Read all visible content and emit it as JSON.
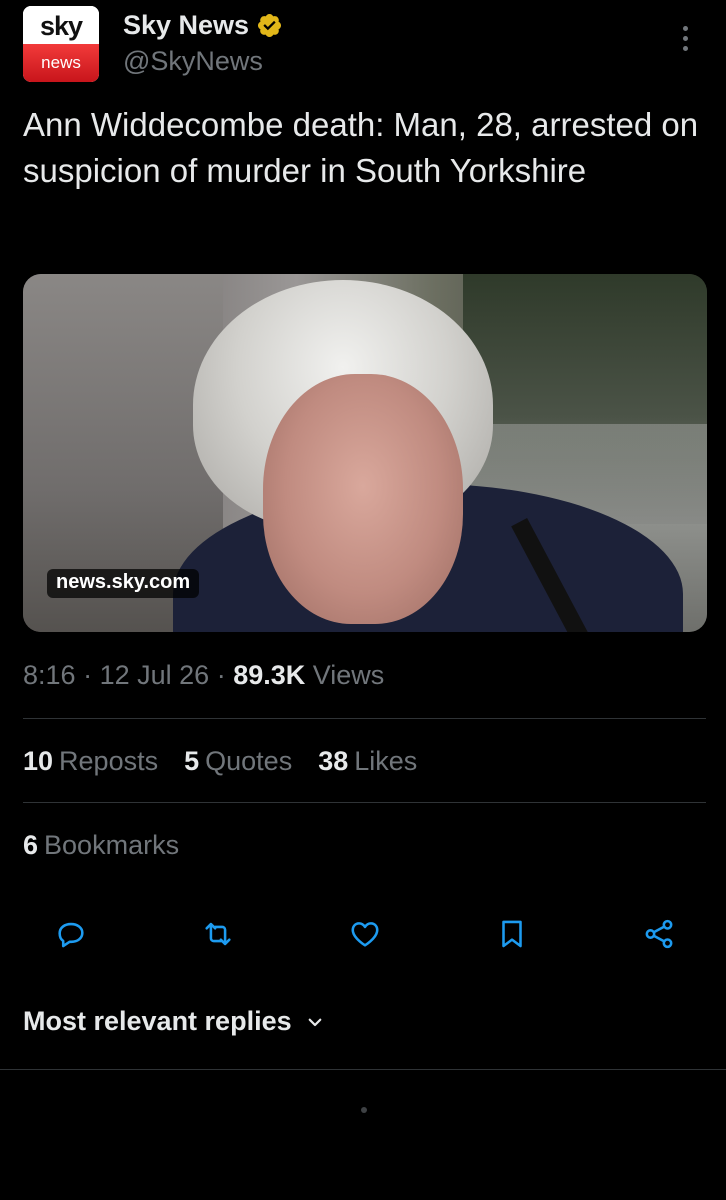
{
  "account": {
    "avatar_top": "sky",
    "avatar_bottom": "news",
    "display_name": "Sky News",
    "handle": "@SkyNews",
    "verified_icon": "verified-badge-icon"
  },
  "tweet": {
    "text": "Ann Widdecombe death: Man, 28, arrested on suspicion of murder in South Yorkshire",
    "link_domain": "news.sky.com"
  },
  "meta": {
    "time": "8:16",
    "date": "12 Jul 26",
    "views_count": "89.3K",
    "views_label": "Views"
  },
  "stats": {
    "reposts_count": "10",
    "reposts_label": "Reposts",
    "quotes_count": "5",
    "quotes_label": "Quotes",
    "likes_count": "38",
    "likes_label": "Likes",
    "bookmarks_count": "6",
    "bookmarks_label": "Bookmarks"
  },
  "actions": [
    "reply-icon",
    "repost-icon",
    "like-icon",
    "bookmark-icon",
    "share-icon"
  ],
  "replies": {
    "sort_label": "Most relevant replies"
  },
  "colors": {
    "background": "#000000",
    "text_primary": "#e7e9ea",
    "text_secondary": "#71767b",
    "divider": "#2f3336",
    "verified": "#e2b719",
    "avatar_red": "#c8151b"
  }
}
